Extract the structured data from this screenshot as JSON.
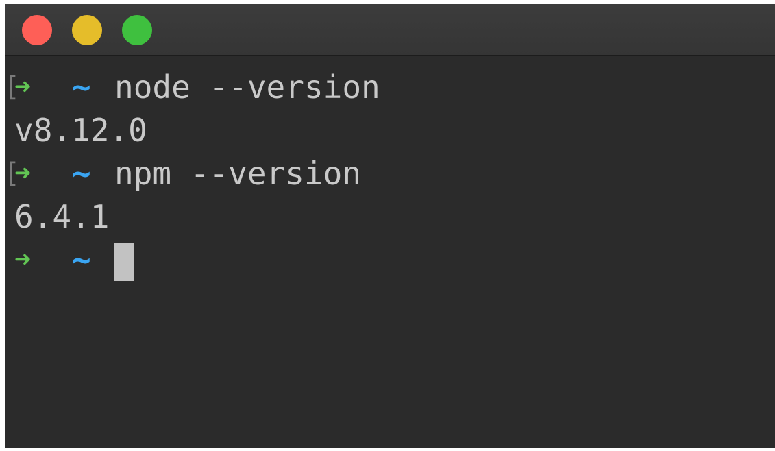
{
  "window": {
    "controls": [
      {
        "name": "close",
        "color": "#fe5f57"
      },
      {
        "name": "minimize",
        "color": "#e5bd2a"
      },
      {
        "name": "zoom",
        "color": "#3fc03f"
      }
    ]
  },
  "terminal": {
    "colors": {
      "arrow": "#62c554",
      "tilde": "#3aa5f2",
      "text": "#c9c9c9",
      "cursor": "#c2c2c2"
    },
    "prompt": {
      "bracket": "[",
      "arrow": "➜",
      "cwd": "~"
    },
    "lines": [
      {
        "type": "command",
        "text": "node --version"
      },
      {
        "type": "output",
        "text": "v8.12.0"
      },
      {
        "type": "command",
        "text": "npm --version"
      },
      {
        "type": "output",
        "text": "6.4.1"
      }
    ],
    "current_input": ""
  }
}
